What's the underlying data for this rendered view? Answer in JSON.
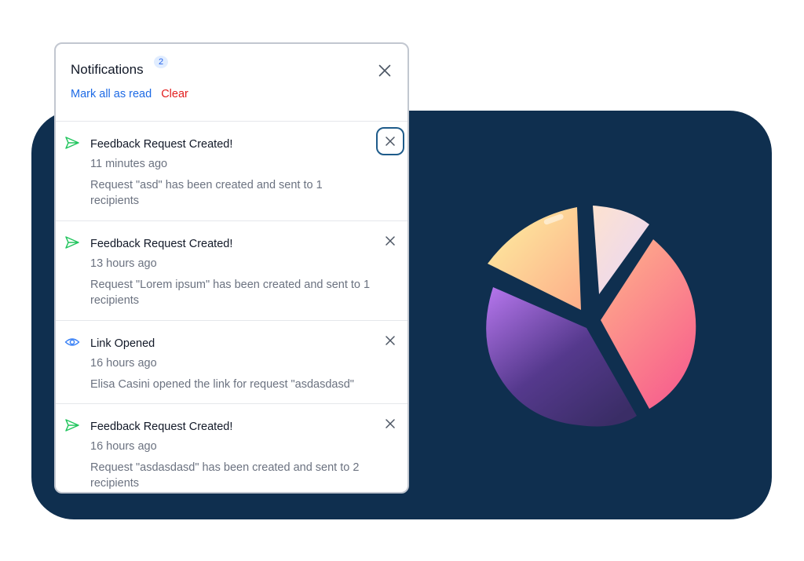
{
  "notifications_panel": {
    "title": "Notifications",
    "unread_count": "2",
    "mark_all_read_label": "Mark all as read",
    "clear_label": "Clear",
    "close_icon": "close-icon",
    "colors": {
      "link_blue": "#1d6ae5",
      "clear_red": "#e21d1d",
      "send_icon_green": "#22c55e",
      "eye_icon_blue": "#3b82f6",
      "backdrop_navy": "#0f2f4f"
    },
    "items": [
      {
        "icon": "send-icon",
        "title": "Feedback Request Created!",
        "time": "11 minutes ago",
        "body": "Request \"asd\" has been created and sent to 1 recipients"
      },
      {
        "icon": "send-icon",
        "title": "Feedback Request Created!",
        "time": "13 hours ago",
        "body": "Request \"Lorem ipsum\" has been created and sent to 1 recipients"
      },
      {
        "icon": "eye-icon",
        "title": "Link Opened",
        "time": "16 hours ago",
        "body": "Elisa Casini opened the link for request \"asdasdasd\""
      },
      {
        "icon": "send-icon",
        "title": "Feedback Request Created!",
        "time": "16 hours ago",
        "body": "Request \"asdasdasd\" has been created and sent to 2 recipients"
      }
    ]
  },
  "decoration": {
    "illustration": "pie-chart-illustration"
  }
}
